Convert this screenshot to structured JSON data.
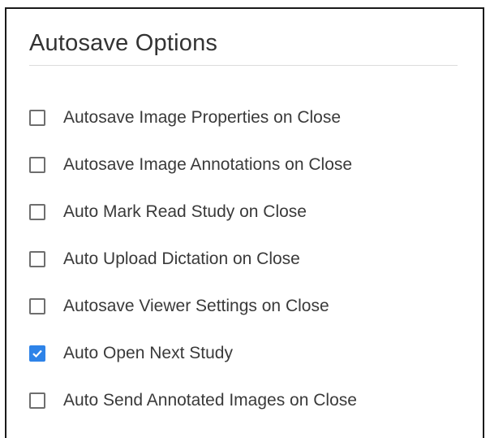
{
  "section": {
    "title": "Autosave Options"
  },
  "options": [
    {
      "label": "Autosave Image Properties on Close",
      "checked": false
    },
    {
      "label": "Autosave Image Annotations on Close",
      "checked": false
    },
    {
      "label": "Auto Mark Read Study on Close",
      "checked": false
    },
    {
      "label": "Auto Upload Dictation on Close",
      "checked": false
    },
    {
      "label": "Autosave Viewer Settings on Close",
      "checked": false
    },
    {
      "label": "Auto Open Next Study",
      "checked": true
    },
    {
      "label": "Auto Send Annotated Images on Close",
      "checked": false
    }
  ],
  "colors": {
    "checkbox_checked": "#2e83e8",
    "checkbox_border": "#6e6e6e",
    "text": "#3a3a3a",
    "divider": "#dcdcdc"
  },
  "icons": {
    "checkmark": "checkmark-icon"
  }
}
